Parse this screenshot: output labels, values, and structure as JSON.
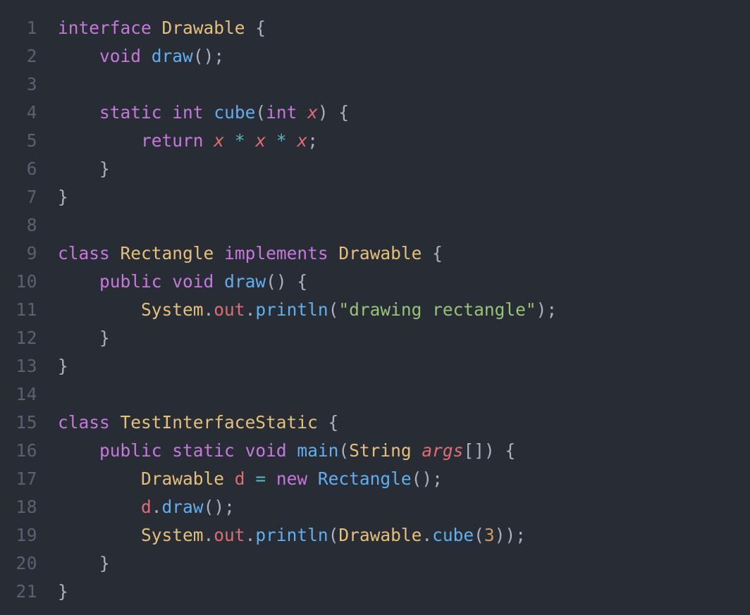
{
  "editor": {
    "language": "java",
    "theme": "one-dark",
    "background_color": "#282c34",
    "gutter_color": "#5a6172",
    "total_lines": 21,
    "colors": {
      "keyword": "#c678dd",
      "type": "#e5c07b",
      "function": "#61afef",
      "variable": "#e06c75",
      "string": "#98c379",
      "number": "#d19a66",
      "operator": "#56b6c2",
      "punctuation": "#abb2bf"
    },
    "lines": [
      {
        "number": "1",
        "text": "interface Drawable {",
        "tokens": [
          {
            "t": "interface",
            "c": "kw"
          },
          {
            "t": " ",
            "c": "pun"
          },
          {
            "t": "Drawable",
            "c": "type"
          },
          {
            "t": " {",
            "c": "pun"
          }
        ]
      },
      {
        "number": "2",
        "text": "    void draw();",
        "tokens": [
          {
            "t": "    ",
            "c": "pun"
          },
          {
            "t": "void",
            "c": "kw"
          },
          {
            "t": " ",
            "c": "pun"
          },
          {
            "t": "draw",
            "c": "fn"
          },
          {
            "t": "();",
            "c": "pun"
          }
        ]
      },
      {
        "number": "3",
        "text": "",
        "tokens": []
      },
      {
        "number": "4",
        "text": "    static int cube(int x) {",
        "tokens": [
          {
            "t": "    ",
            "c": "pun"
          },
          {
            "t": "static",
            "c": "kw"
          },
          {
            "t": " ",
            "c": "pun"
          },
          {
            "t": "int",
            "c": "kw"
          },
          {
            "t": " ",
            "c": "pun"
          },
          {
            "t": "cube",
            "c": "fn"
          },
          {
            "t": "(",
            "c": "pun"
          },
          {
            "t": "int",
            "c": "kw"
          },
          {
            "t": " ",
            "c": "pun"
          },
          {
            "t": "x",
            "c": "vari"
          },
          {
            "t": ") {",
            "c": "pun"
          }
        ]
      },
      {
        "number": "5",
        "text": "        return x * x * x;",
        "tokens": [
          {
            "t": "        ",
            "c": "pun"
          },
          {
            "t": "return",
            "c": "kw"
          },
          {
            "t": " ",
            "c": "pun"
          },
          {
            "t": "x",
            "c": "vari"
          },
          {
            "t": " ",
            "c": "pun"
          },
          {
            "t": "*",
            "c": "op"
          },
          {
            "t": " ",
            "c": "pun"
          },
          {
            "t": "x",
            "c": "vari"
          },
          {
            "t": " ",
            "c": "pun"
          },
          {
            "t": "*",
            "c": "op"
          },
          {
            "t": " ",
            "c": "pun"
          },
          {
            "t": "x",
            "c": "vari"
          },
          {
            "t": ";",
            "c": "pun"
          }
        ]
      },
      {
        "number": "6",
        "text": "    }",
        "tokens": [
          {
            "t": "    }",
            "c": "pun"
          }
        ]
      },
      {
        "number": "7",
        "text": "}",
        "tokens": [
          {
            "t": "}",
            "c": "pun"
          }
        ]
      },
      {
        "number": "8",
        "text": "",
        "tokens": []
      },
      {
        "number": "9",
        "text": "class Rectangle implements Drawable {",
        "tokens": [
          {
            "t": "class",
            "c": "kw"
          },
          {
            "t": " ",
            "c": "pun"
          },
          {
            "t": "Rectangle",
            "c": "type"
          },
          {
            "t": " ",
            "c": "pun"
          },
          {
            "t": "implements",
            "c": "kw"
          },
          {
            "t": " ",
            "c": "pun"
          },
          {
            "t": "Drawable",
            "c": "type"
          },
          {
            "t": " {",
            "c": "pun"
          }
        ]
      },
      {
        "number": "10",
        "text": "    public void draw() {",
        "tokens": [
          {
            "t": "    ",
            "c": "pun"
          },
          {
            "t": "public",
            "c": "kw"
          },
          {
            "t": " ",
            "c": "pun"
          },
          {
            "t": "void",
            "c": "kw"
          },
          {
            "t": " ",
            "c": "pun"
          },
          {
            "t": "draw",
            "c": "fn"
          },
          {
            "t": "() {",
            "c": "pun"
          }
        ]
      },
      {
        "number": "11",
        "text": "        System.out.println(\"drawing rectangle\");",
        "tokens": [
          {
            "t": "        ",
            "c": "pun"
          },
          {
            "t": "System",
            "c": "type"
          },
          {
            "t": ".",
            "c": "pun"
          },
          {
            "t": "out",
            "c": "var"
          },
          {
            "t": ".",
            "c": "pun"
          },
          {
            "t": "println",
            "c": "fn"
          },
          {
            "t": "(",
            "c": "pun"
          },
          {
            "t": "\"drawing rectangle\"",
            "c": "str"
          },
          {
            "t": ");",
            "c": "pun"
          }
        ]
      },
      {
        "number": "12",
        "text": "    }",
        "tokens": [
          {
            "t": "    }",
            "c": "pun"
          }
        ]
      },
      {
        "number": "13",
        "text": "}",
        "tokens": [
          {
            "t": "}",
            "c": "pun"
          }
        ]
      },
      {
        "number": "14",
        "text": "",
        "tokens": []
      },
      {
        "number": "15",
        "text": "class TestInterfaceStatic {",
        "tokens": [
          {
            "t": "class",
            "c": "kw"
          },
          {
            "t": " ",
            "c": "pun"
          },
          {
            "t": "TestInterfaceStatic",
            "c": "type"
          },
          {
            "t": " {",
            "c": "pun"
          }
        ]
      },
      {
        "number": "16",
        "text": "    public static void main(String args[]) {",
        "tokens": [
          {
            "t": "    ",
            "c": "pun"
          },
          {
            "t": "public",
            "c": "kw"
          },
          {
            "t": " ",
            "c": "pun"
          },
          {
            "t": "static",
            "c": "kw"
          },
          {
            "t": " ",
            "c": "pun"
          },
          {
            "t": "void",
            "c": "kw"
          },
          {
            "t": " ",
            "c": "pun"
          },
          {
            "t": "main",
            "c": "fn"
          },
          {
            "t": "(",
            "c": "pun"
          },
          {
            "t": "String",
            "c": "type"
          },
          {
            "t": " ",
            "c": "pun"
          },
          {
            "t": "args",
            "c": "vari"
          },
          {
            "t": "[]) {",
            "c": "pun"
          }
        ]
      },
      {
        "number": "17",
        "text": "        Drawable d = new Rectangle();",
        "tokens": [
          {
            "t": "        ",
            "c": "pun"
          },
          {
            "t": "Drawable",
            "c": "type"
          },
          {
            "t": " ",
            "c": "pun"
          },
          {
            "t": "d",
            "c": "var"
          },
          {
            "t": " ",
            "c": "pun"
          },
          {
            "t": "=",
            "c": "op"
          },
          {
            "t": " ",
            "c": "pun"
          },
          {
            "t": "new",
            "c": "kw"
          },
          {
            "t": " ",
            "c": "pun"
          },
          {
            "t": "Rectangle",
            "c": "fn"
          },
          {
            "t": "();",
            "c": "pun"
          }
        ]
      },
      {
        "number": "18",
        "text": "        d.draw();",
        "tokens": [
          {
            "t": "        ",
            "c": "pun"
          },
          {
            "t": "d",
            "c": "var"
          },
          {
            "t": ".",
            "c": "pun"
          },
          {
            "t": "draw",
            "c": "fn"
          },
          {
            "t": "();",
            "c": "pun"
          }
        ]
      },
      {
        "number": "19",
        "text": "        System.out.println(Drawable.cube(3));",
        "tokens": [
          {
            "t": "        ",
            "c": "pun"
          },
          {
            "t": "System",
            "c": "type"
          },
          {
            "t": ".",
            "c": "pun"
          },
          {
            "t": "out",
            "c": "var"
          },
          {
            "t": ".",
            "c": "pun"
          },
          {
            "t": "println",
            "c": "fn"
          },
          {
            "t": "(",
            "c": "pun"
          },
          {
            "t": "Drawable",
            "c": "type"
          },
          {
            "t": ".",
            "c": "pun"
          },
          {
            "t": "cube",
            "c": "fn"
          },
          {
            "t": "(",
            "c": "pun"
          },
          {
            "t": "3",
            "c": "num"
          },
          {
            "t": "));",
            "c": "pun"
          }
        ]
      },
      {
        "number": "20",
        "text": "    }",
        "tokens": [
          {
            "t": "    }",
            "c": "pun"
          }
        ]
      },
      {
        "number": "21",
        "text": "}",
        "tokens": [
          {
            "t": "}",
            "c": "pun"
          }
        ]
      }
    ]
  }
}
